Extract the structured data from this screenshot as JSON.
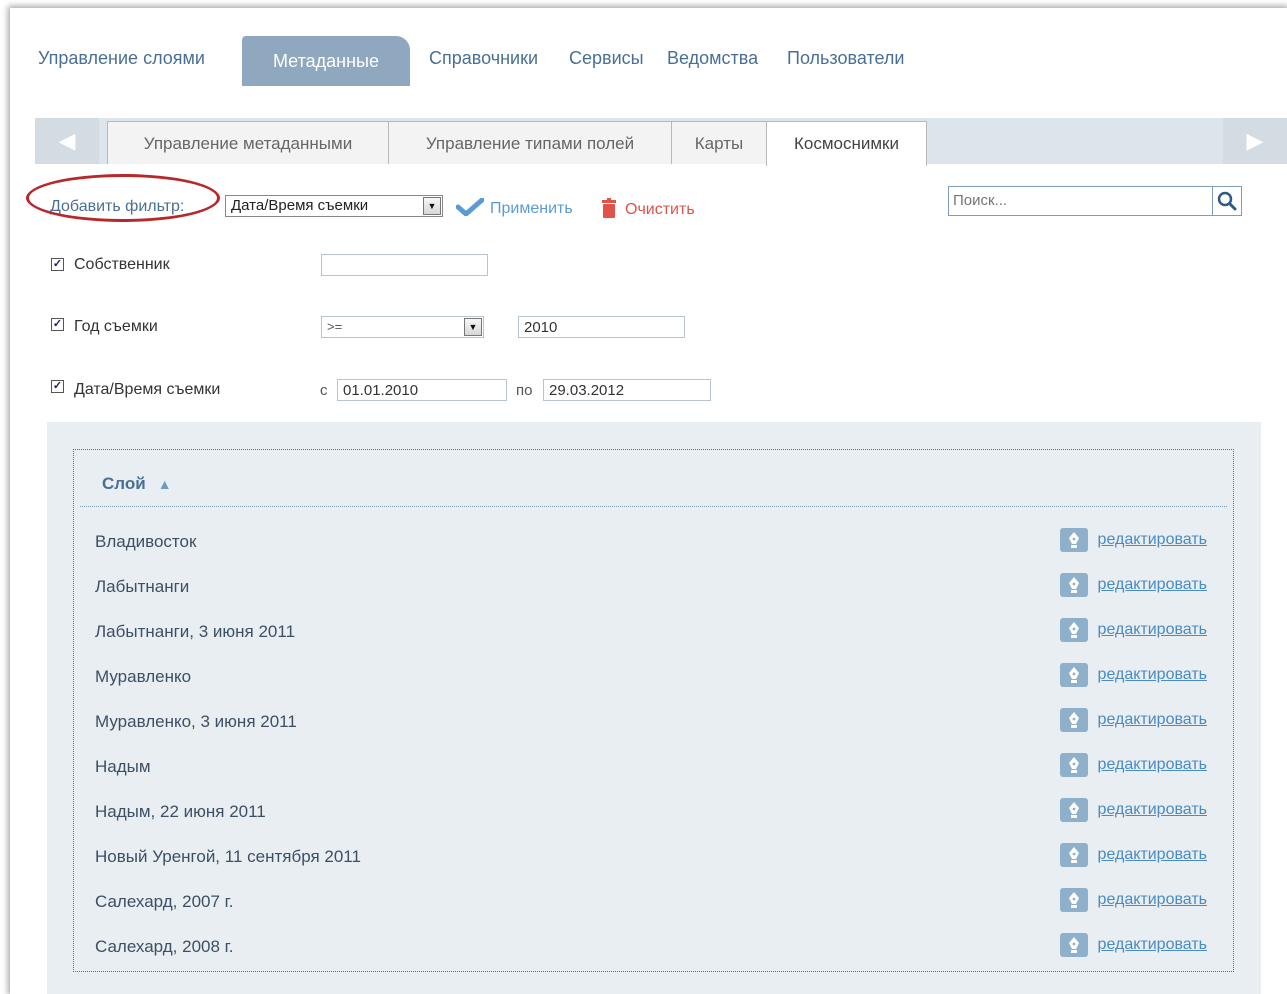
{
  "topnav": {
    "items": [
      "Управление слоями",
      "Метаданные",
      "Справочники",
      "Сервисы",
      "Ведомства",
      "Пользователи"
    ]
  },
  "subtabs": [
    "Управление метаданными",
    "Управление типами полей",
    "Карты",
    "Космоснимки"
  ],
  "filter": {
    "add_label": "Добавить фильтр:",
    "select_value": "Дата/Время съемки",
    "apply": "Применить",
    "clear": "Очистить",
    "search_placeholder": "Поиск..."
  },
  "fields": {
    "owner": {
      "label": "Собственник",
      "value": ""
    },
    "year": {
      "label": "Год съемки",
      "operator": ">=",
      "value": "2010"
    },
    "date": {
      "label": "Дата/Время съемки",
      "from_label": "с",
      "from": "01.01.2010",
      "to_label": "по",
      "to": "29.03.2012"
    }
  },
  "grid": {
    "header": "Слой",
    "edit_label": "редактировать",
    "rows": [
      "Владивосток",
      "Лабытнанги",
      "Лабытнанги, 3 июня 2011",
      "Муравленко",
      "Муравленко, 3 июня 2011",
      "Надым",
      "Надым, 22 июня 2011",
      "Новый Уренгой, 11 сентября 2011",
      "Салехард, 2007 г.",
      "Салехард, 2008 г."
    ]
  },
  "colors": {
    "accent": "#4a6f95",
    "active_tab": "#8fa8bf",
    "clear": "#e0524a",
    "apply": "#5b9bd5",
    "highlight": "#b8282a"
  },
  "icons": {
    "apply": "checkmark-icon",
    "clear": "trash-icon",
    "search": "magnifier-icon",
    "edit": "pen-nib-icon"
  }
}
